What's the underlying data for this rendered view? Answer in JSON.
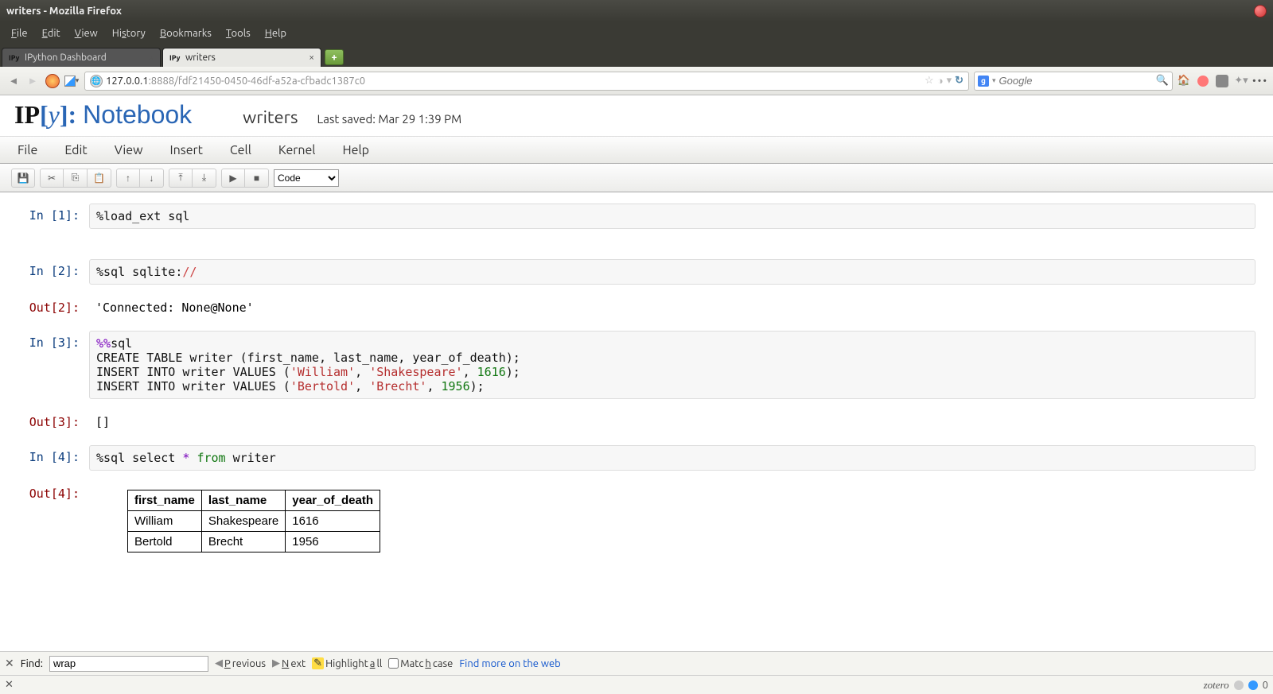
{
  "window": {
    "title": "writers - Mozilla Firefox"
  },
  "ff_menu": [
    "File",
    "Edit",
    "View",
    "History",
    "Bookmarks",
    "Tools",
    "Help"
  ],
  "tabs": [
    {
      "label": "IPython Dashboard",
      "active": false,
      "favicon": "IPy"
    },
    {
      "label": "writers",
      "active": true,
      "favicon": "IPy"
    }
  ],
  "address": {
    "full": "127.0.0.1:8888/fdf21450-0450-46df-a52a-cfbadc1387c0",
    "host": "127.0.0.1"
  },
  "search": {
    "placeholder": "Google",
    "favicon": "g"
  },
  "notebook": {
    "logo_text": "IP[y]: Notebook",
    "name": "writers",
    "last_saved_label": "Last saved: Mar 29 1:39 PM",
    "menus": [
      "File",
      "Edit",
      "View",
      "Insert",
      "Cell",
      "Kernel",
      "Help"
    ],
    "cell_type": "Code"
  },
  "cells": {
    "in1_prompt": "In [1]:",
    "in1_code": [
      {
        "cls": "plain",
        "t": "%load_ext sql"
      }
    ],
    "in2_prompt": "In [2]:",
    "in2_code": [
      {
        "cls": "plain",
        "t": "%sql sqlite:"
      },
      {
        "cls": "mag",
        "t": "//"
      }
    ],
    "out2_prompt": "Out[2]:",
    "out2_text": "'Connected: None@None'",
    "in3_prompt": "In [3]:",
    "in3_code_raw": "%%sql\nCREATE TABLE writer (first_name, last_name, year_of_death);\nINSERT INTO writer VALUES ('William', 'Shakespeare', 1616);\nINSERT INTO writer VALUES ('Bertold', 'Brecht', 1956);",
    "out3_prompt": "Out[3]:",
    "out3_text": "[]",
    "in4_prompt": "In [4]:",
    "in4_code_raw": "%sql select * from writer",
    "out4_prompt": "Out[4]:"
  },
  "chart_data": {
    "type": "table",
    "headers": [
      "first_name",
      "last_name",
      "year_of_death"
    ],
    "rows": [
      [
        "William",
        "Shakespeare",
        "1616"
      ],
      [
        "Bertold",
        "Brecht",
        "1956"
      ]
    ]
  },
  "findbar": {
    "label": "Find:",
    "value": "wrap",
    "prev": "Previous",
    "next": "Next",
    "highlight": "Highlight all",
    "matchcase": "Match case",
    "webfind": "Find more on the web"
  },
  "addonbar": {
    "zotero": "zotero",
    "count": "0"
  }
}
